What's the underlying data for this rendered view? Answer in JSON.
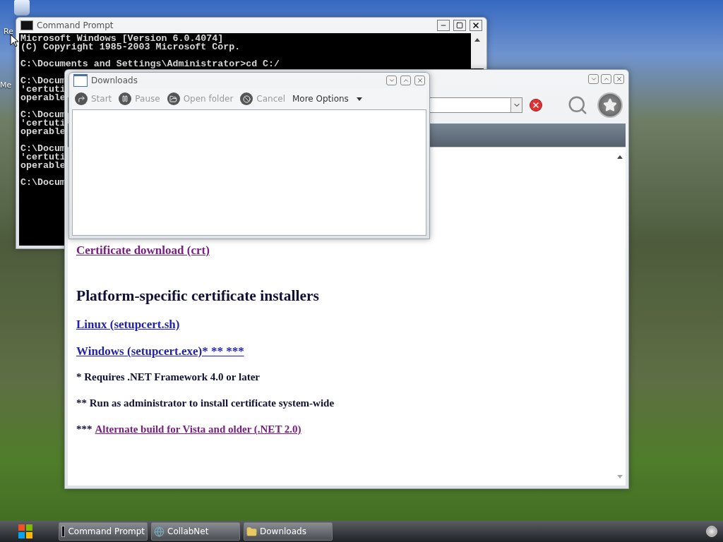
{
  "desktop_icons": [
    {
      "label": "Re"
    },
    {
      "label": "Me"
    }
  ],
  "command_prompt": {
    "title": "Command Prompt",
    "console_blocks": [
      [
        "Microsoft Windows [Version 6.0.4074]",
        "(C) Copyright 1985-2003 Microsoft Corp."
      ],
      [
        "C:\\Documents and Settings\\Administrator>cd C:/"
      ],
      [
        "C:\\Docum",
        "'certuti",
        "operable"
      ],
      [
        "C:\\Docum",
        "'certuti",
        "operable"
      ],
      [
        "C:\\Docum",
        "'certuti",
        "operable"
      ],
      [
        "C:\\Docum"
      ]
    ]
  },
  "browser": {
    "content": [
      {
        "kind": "link",
        "text": "Certificate download (crt)",
        "visited": true
      },
      {
        "kind": "heading",
        "text": "Platform-specific certificate installers"
      },
      {
        "kind": "link",
        "text": "Linux (setupcert.sh)",
        "visited": false
      },
      {
        "kind": "link",
        "text": "Windows (setupcert.exe)* ** ***",
        "visited": false
      },
      {
        "kind": "note",
        "text": "* Requires .NET Framework 4.0 or later"
      },
      {
        "kind": "note",
        "text": "** Run as administrator to install certificate system-wide"
      },
      {
        "kind": "note",
        "text": "***",
        "link": {
          "text": "Alternate build for Vista and older (.NET 2.0)",
          "visited": true
        }
      }
    ]
  },
  "downloads": {
    "title": "Downloads",
    "toolbar": [
      {
        "kind": "start",
        "label": "Start",
        "disabled": true
      },
      {
        "kind": "pause",
        "label": "Pause",
        "disabled": true
      },
      {
        "kind": "folder",
        "label": "Open folder",
        "disabled": true
      },
      {
        "kind": "cancel",
        "label": "Cancel",
        "disabled": true
      },
      {
        "kind": "menu",
        "label": "More Options",
        "disabled": false
      }
    ]
  },
  "taskbar": {
    "items": [
      {
        "kind": "console",
        "label": "Command Prompt"
      },
      {
        "kind": "browser",
        "label": "CollabNet"
      },
      {
        "kind": "folder",
        "label": "Downloads"
      }
    ]
  }
}
